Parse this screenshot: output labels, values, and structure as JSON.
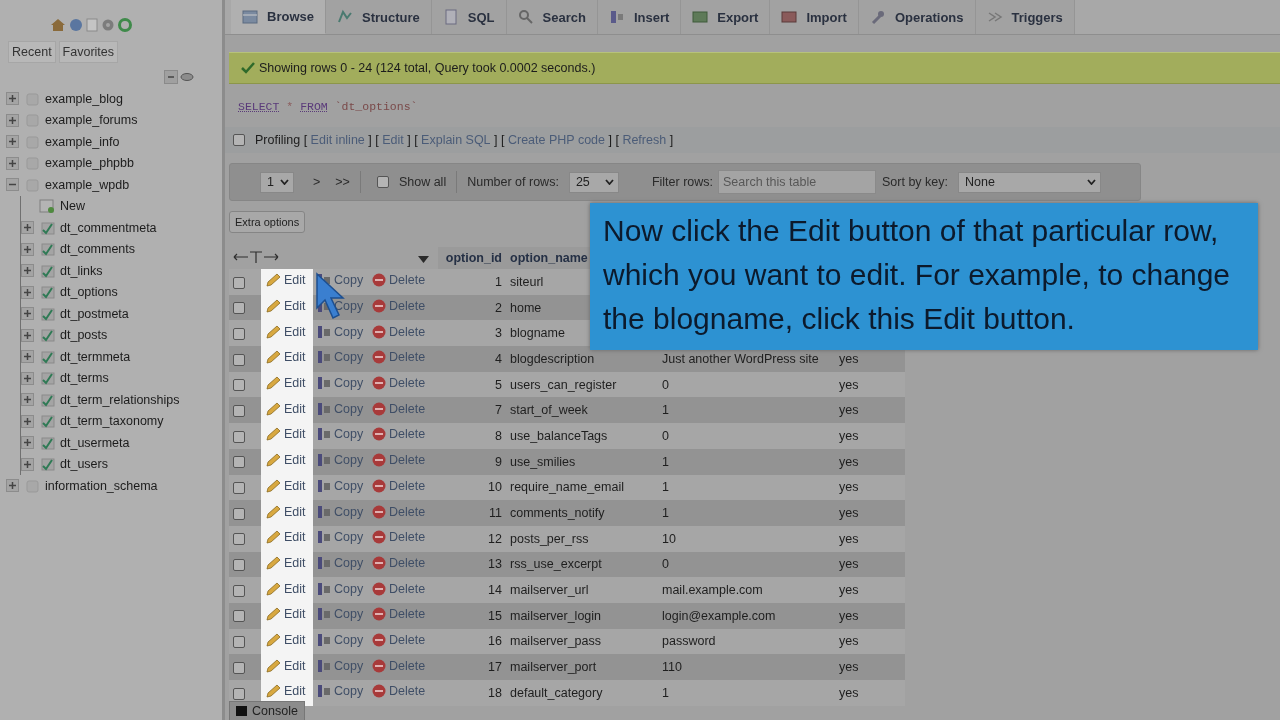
{
  "sidebar": {
    "tabs": [
      {
        "label": "Recent"
      },
      {
        "label": "Favorites"
      }
    ],
    "tree": [
      {
        "label": "example_blog",
        "kind": "database",
        "expanded": false
      },
      {
        "label": "example_forums",
        "kind": "database",
        "expanded": false
      },
      {
        "label": "example_info",
        "kind": "database",
        "expanded": false
      },
      {
        "label": "example_phpbb",
        "kind": "database",
        "expanded": false
      },
      {
        "label": "example_wpdb",
        "kind": "database",
        "expanded": true,
        "children": [
          {
            "label": "New",
            "kind": "new"
          },
          {
            "label": "dt_commentmeta",
            "kind": "table",
            "expanded": false
          },
          {
            "label": "dt_comments",
            "kind": "table",
            "expanded": false
          },
          {
            "label": "dt_links",
            "kind": "table",
            "expanded": false
          },
          {
            "label": "dt_options",
            "kind": "table",
            "expanded": false
          },
          {
            "label": "dt_postmeta",
            "kind": "table",
            "expanded": false
          },
          {
            "label": "dt_posts",
            "kind": "table",
            "expanded": false
          },
          {
            "label": "dt_termmeta",
            "kind": "table",
            "expanded": false
          },
          {
            "label": "dt_terms",
            "kind": "table",
            "expanded": false
          },
          {
            "label": "dt_term_relationships",
            "kind": "table",
            "expanded": false
          },
          {
            "label": "dt_term_taxonomy",
            "kind": "table",
            "expanded": false
          },
          {
            "label": "dt_usermeta",
            "kind": "table",
            "expanded": false
          },
          {
            "label": "dt_users",
            "kind": "table",
            "expanded": false
          }
        ]
      },
      {
        "label": "information_schema",
        "kind": "database",
        "expanded": false
      }
    ]
  },
  "tabs": [
    {
      "label": "Browse",
      "selected": true
    },
    {
      "label": "Structure",
      "selected": false
    },
    {
      "label": "SQL",
      "selected": false
    },
    {
      "label": "Search",
      "selected": false
    },
    {
      "label": "Insert",
      "selected": false
    },
    {
      "label": "Export",
      "selected": false
    },
    {
      "label": "Import",
      "selected": false
    },
    {
      "label": "Operations",
      "selected": false
    },
    {
      "label": "Triggers",
      "selected": false
    }
  ],
  "notice": "Showing rows 0 - 24 (124 total, Query took 0.0002 seconds.)",
  "sql": {
    "keyword1": "SELECT",
    "star": "*",
    "keyword2": "FROM",
    "table": "`dt_options`"
  },
  "profiling": {
    "label": "Profiling",
    "checked": false,
    "open": "[",
    "close": "]",
    "links": [
      "Edit inline",
      "Edit",
      "Explain SQL",
      "Create PHP code",
      "Refresh"
    ]
  },
  "navigation": {
    "page": "1",
    "next": ">",
    "last": ">>",
    "show_all": {
      "label": "Show all",
      "checked": false
    },
    "rows_label": "Number of rows:",
    "rows": "25",
    "filter_label": "Filter rows:",
    "filter_placeholder": "Search this table",
    "sort_label": "Sort by key:",
    "sort": "None"
  },
  "extra_options": "Extra options",
  "table": {
    "columns": [
      "option_id",
      "option_name"
    ],
    "rows": [
      {
        "checked": false,
        "edit": "Edit",
        "edit_highlighted": true,
        "copy": "Copy",
        "delete": "Delete",
        "option_id": "1",
        "option_name": "siteurl"
      },
      {
        "checked": false,
        "edit": "Edit",
        "edit_highlighted": true,
        "copy": "Copy",
        "delete": "Delete",
        "option_id": "2",
        "option_name": "home"
      },
      {
        "checked": false,
        "edit": "Edit",
        "edit_highlighted": true,
        "copy": "Copy",
        "delete": "Delete",
        "option_id": "3",
        "option_name": "blogname"
      },
      {
        "checked": false,
        "edit": "Edit",
        "edit_highlighted": true,
        "copy": "Copy",
        "delete": "Delete",
        "option_id": "4",
        "option_name": "blogdescription",
        "option_value": "Just another WordPress site",
        "autoload": "yes"
      },
      {
        "checked": false,
        "edit": "Edit",
        "edit_highlighted": true,
        "copy": "Copy",
        "delete": "Delete",
        "option_id": "5",
        "option_name": "users_can_register",
        "option_value": "0",
        "autoload": "yes"
      },
      {
        "checked": false,
        "edit": "Edit",
        "edit_highlighted": true,
        "copy": "Copy",
        "delete": "Delete",
        "option_id": "7",
        "option_name": "start_of_week",
        "option_value": "1",
        "autoload": "yes"
      },
      {
        "checked": false,
        "edit": "Edit",
        "edit_highlighted": true,
        "copy": "Copy",
        "delete": "Delete",
        "option_id": "8",
        "option_name": "use_balanceTags",
        "option_value": "0",
        "autoload": "yes"
      },
      {
        "checked": false,
        "edit": "Edit",
        "edit_highlighted": true,
        "copy": "Copy",
        "delete": "Delete",
        "option_id": "9",
        "option_name": "use_smilies",
        "option_value": "1",
        "autoload": "yes"
      },
      {
        "checked": false,
        "edit": "Edit",
        "edit_highlighted": true,
        "copy": "Copy",
        "delete": "Delete",
        "option_id": "10",
        "option_name": "require_name_email",
        "option_value": "1",
        "autoload": "yes"
      },
      {
        "checked": false,
        "edit": "Edit",
        "edit_highlighted": true,
        "copy": "Copy",
        "delete": "Delete",
        "option_id": "11",
        "option_name": "comments_notify",
        "option_value": "1",
        "autoload": "yes"
      },
      {
        "checked": false,
        "edit": "Edit",
        "edit_highlighted": true,
        "copy": "Copy",
        "delete": "Delete",
        "option_id": "12",
        "option_name": "posts_per_rss",
        "option_value": "10",
        "autoload": "yes"
      },
      {
        "checked": false,
        "edit": "Edit",
        "edit_highlighted": true,
        "copy": "Copy",
        "delete": "Delete",
        "option_id": "13",
        "option_name": "rss_use_excerpt",
        "option_value": "0",
        "autoload": "yes"
      },
      {
        "checked": false,
        "edit": "Edit",
        "edit_highlighted": true,
        "copy": "Copy",
        "delete": "Delete",
        "option_id": "14",
        "option_name": "mailserver_url",
        "option_value": "mail.example.com",
        "autoload": "yes"
      },
      {
        "checked": false,
        "edit": "Edit",
        "edit_highlighted": true,
        "copy": "Copy",
        "delete": "Delete",
        "option_id": "15",
        "option_name": "mailserver_login",
        "option_value": "login@example.com",
        "autoload": "yes"
      },
      {
        "checked": false,
        "edit": "Edit",
        "edit_highlighted": true,
        "copy": "Copy",
        "delete": "Delete",
        "option_id": "16",
        "option_name": "mailserver_pass",
        "option_value": "password",
        "autoload": "yes"
      },
      {
        "checked": false,
        "edit": "Edit",
        "edit_highlighted": true,
        "copy": "Copy",
        "delete": "Delete",
        "option_id": "17",
        "option_name": "mailserver_port",
        "option_value": "110",
        "autoload": "yes"
      },
      {
        "checked": false,
        "edit": "Edit",
        "edit_highlighted": true,
        "copy": "Copy",
        "delete": "Delete",
        "option_id": "18",
        "option_name": "default_category",
        "option_value": "1",
        "autoload": "yes"
      }
    ]
  },
  "callout": "Now click the Edit button of that particular row, which you want to edit. For example, to change the blogname, click this Edit button.",
  "console": "Console"
}
